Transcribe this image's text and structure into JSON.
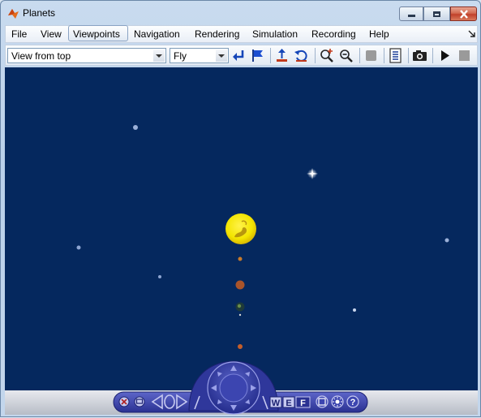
{
  "window": {
    "title": "Planets"
  },
  "menubar": {
    "items": [
      "File",
      "View",
      "Viewpoints",
      "Navigation",
      "Rendering",
      "Simulation",
      "Recording",
      "Help"
    ],
    "active": "Viewpoints"
  },
  "toolbar": {
    "viewpoint_select": "View from top",
    "navigation_select": "Fly",
    "icons": [
      "return-icon",
      "flag-icon",
      "straighten-up-icon",
      "undo-move-icon",
      "zoom-in-icon",
      "zoom-out-icon",
      "record-icon",
      "list-icon",
      "camera-icon",
      "play-icon",
      "stop-icon"
    ]
  },
  "navpanel": {
    "letters": {
      "walk": "W",
      "examine": "E",
      "fly": "F"
    },
    "icons": [
      "close-icon",
      "minimize-icon",
      "move-left-icon",
      "rotate-icon",
      "move-right-icon",
      "navigation-wheel-icon",
      "straighten-icon",
      "fit-icon",
      "headlight-icon",
      "help-icon"
    ],
    "help_glyph": "?"
  },
  "scene": {
    "background_color": "#05285e",
    "sun_color": "#f3e500"
  }
}
